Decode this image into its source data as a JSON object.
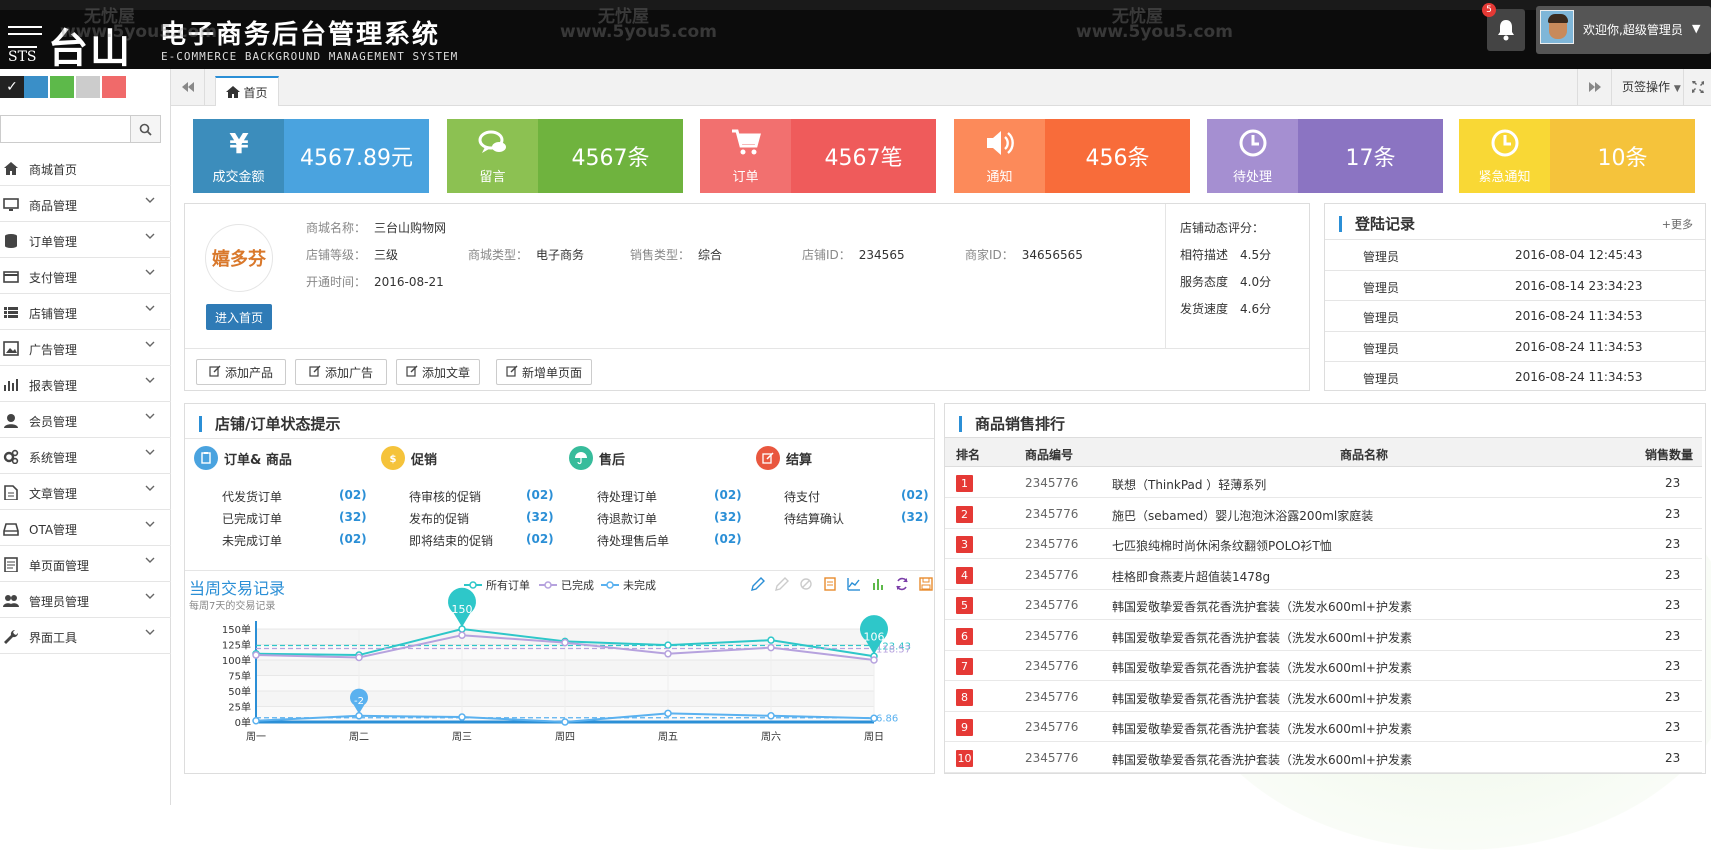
{
  "header": {
    "logo_cn": "台山",
    "logo_sts": "STS",
    "title": "电子商务后台管理系统",
    "subtitle": "E-COMMERCE BACKGROUND MANAGEMENT SYSTEM",
    "notification_count": "5",
    "welcome": "欢迎你,超级管理员"
  },
  "watermarks": {
    "brand": "无忧屋",
    "url": "www.5you5.com"
  },
  "theme_swatches": [
    "#222222",
    "#3a8fc8",
    "#5db94a",
    "#cccccc",
    "#f06a6a"
  ],
  "search": {
    "placeholder": ""
  },
  "sidebar": {
    "items": [
      {
        "label": "商城首页",
        "icon": "home-icon",
        "has_children": false
      },
      {
        "label": "商品管理",
        "icon": "monitor-icon",
        "has_children": true
      },
      {
        "label": "订单管理",
        "icon": "database-icon",
        "has_children": true
      },
      {
        "label": "支付管理",
        "icon": "credit-card-icon",
        "has_children": true
      },
      {
        "label": "店铺管理",
        "icon": "list-icon",
        "has_children": true
      },
      {
        "label": "广告管理",
        "icon": "image-icon",
        "has_children": true
      },
      {
        "label": "报表管理",
        "icon": "bar-chart-icon",
        "has_children": true
      },
      {
        "label": "会员管理",
        "icon": "user-icon",
        "has_children": true
      },
      {
        "label": "系统管理",
        "icon": "cogs-icon",
        "has_children": true
      },
      {
        "label": "文章管理",
        "icon": "file-icon",
        "has_children": true
      },
      {
        "label": "OTA管理",
        "icon": "hdd-icon",
        "has_children": true
      },
      {
        "label": "单页面管理",
        "icon": "file-text-icon",
        "has_children": true
      },
      {
        "label": "管理员管理",
        "icon": "users-icon",
        "has_children": true
      },
      {
        "label": "界面工具",
        "icon": "wrench-icon",
        "has_children": true
      }
    ]
  },
  "tabs": {
    "home_label": "首页",
    "ops_label": "页签操作"
  },
  "stats": [
    {
      "icon": "yen-icon",
      "label": "成交金额",
      "value": "4567.89元",
      "left_color": "#3c8dbc",
      "right_color": "#4aa3df"
    },
    {
      "icon": "comments-icon",
      "label": "留言",
      "value": "4567条",
      "left_color": "#8cc152",
      "right_color": "#6fb33e"
    },
    {
      "icon": "cart-icon",
      "label": "订单",
      "value": "4567笔",
      "left_color": "#f2706f",
      "right_color": "#ef5b5b"
    },
    {
      "icon": "volume-icon",
      "label": "通知",
      "value": "456条",
      "left_color": "#fc8a5a",
      "right_color": "#f86c3a"
    },
    {
      "icon": "clock-icon",
      "label": "待处理",
      "value": "17条",
      "left_color": "#a58fd1",
      "right_color": "#8b74c2"
    },
    {
      "icon": "clock-icon",
      "label": "紧急通知",
      "value": "10条",
      "left_color": "#f9d835",
      "right_color": "#f5c33b"
    }
  ],
  "shop": {
    "logo_text": "嬉多芬",
    "enter_button": "进入首页",
    "name_label": "商城名称：",
    "name": "三台山购物网",
    "level_label": "店铺等级：",
    "level": "三级",
    "type_label": "商城类型：",
    "type": "电子商务",
    "sales_type_label": "销售类型：",
    "sales_type": "综合",
    "id_label": "店铺ID：",
    "id": "234565",
    "merchant_id_label": "商家ID：",
    "merchant_id": "34656565",
    "open_label": "开通时间：",
    "open_time": "2016-08-21",
    "rating_title": "店铺动态评分：",
    "ratings": [
      {
        "label": "相符描述",
        "value": "4.5分"
      },
      {
        "label": "服务态度",
        "value": "4.0分"
      },
      {
        "label": "发货速度",
        "value": "4.6分"
      }
    ],
    "actions": [
      "添加产品",
      "添加广告",
      "添加文章",
      "新增单页面"
    ]
  },
  "login_log": {
    "title": "登陆记录",
    "more": "+更多",
    "rows": [
      {
        "user": "管理员",
        "time": "2016-08-04 12:45:43"
      },
      {
        "user": "管理员",
        "time": "2016-08-14 23:34:23"
      },
      {
        "user": "管理员",
        "time": "2016-08-24 11:34:53"
      },
      {
        "user": "管理员",
        "time": "2016-08-24 11:34:53"
      },
      {
        "user": "管理员",
        "time": "2016-08-24 11:34:53"
      }
    ]
  },
  "status_panel": {
    "title": "店铺/订单状态提示",
    "categories": [
      {
        "title": "订单& 商品",
        "color": "#4aa3df",
        "icon": "clipboard-icon",
        "items": [
          {
            "label": "代发货订单",
            "count": "(02)"
          },
          {
            "label": "已完成订单",
            "count": "(32)"
          },
          {
            "label": "未完成订单",
            "count": "(02)"
          }
        ]
      },
      {
        "title": "促销",
        "color": "#f5c33b",
        "icon": "coin-icon",
        "items": [
          {
            "label": "待审核的促销",
            "count": "(02)"
          },
          {
            "label": "发布的促销",
            "count": "(32)"
          },
          {
            "label": "即将结束的促销",
            "count": "(02)"
          }
        ]
      },
      {
        "title": "售后",
        "color": "#37bc9b",
        "icon": "umbrella-icon",
        "items": [
          {
            "label": "待处理订单",
            "count": "(02)"
          },
          {
            "label": "待退款订单",
            "count": "(32)"
          },
          {
            "label": "待处理售后单",
            "count": "(02)"
          }
        ]
      },
      {
        "title": "结算",
        "color": "#e9573f",
        "icon": "edit-icon",
        "items": [
          {
            "label": "待支付",
            "count": "(02)"
          },
          {
            "label": "待结算确认",
            "count": "(32)"
          }
        ]
      }
    ]
  },
  "chart_data": {
    "type": "line",
    "title": "当周交易记录",
    "subtitle": "每周7天的交易记录",
    "categories": [
      "周一",
      "周二",
      "周三",
      "周四",
      "周五",
      "周六",
      "周日"
    ],
    "y_ticks": [
      "0单",
      "25单",
      "50单",
      "75单",
      "100单",
      "125单",
      "150单"
    ],
    "ylim": [
      0,
      150
    ],
    "series": [
      {
        "name": "所有订单",
        "color": "#2ec7c9",
        "values": [
          110,
          108,
          150,
          130,
          124,
          132,
          106
        ],
        "average": 123.43
      },
      {
        "name": "已完成",
        "color": "#b6a2de",
        "values": [
          108,
          104,
          140,
          128,
          110,
          120,
          100
        ],
        "average": 118.57
      },
      {
        "name": "未完成",
        "color": "#5ab1ef",
        "values": [
          2,
          10,
          8,
          0,
          14,
          10,
          6
        ],
        "average": 6.86
      }
    ],
    "markers": [
      {
        "label": "150",
        "series": 0,
        "index": 2
      },
      {
        "label": "106",
        "series": 0,
        "index": 6
      },
      {
        "label": "-2",
        "series": 2,
        "index": 1
      }
    ],
    "average_labels": [
      "123.43",
      "118.57",
      "6.86"
    ]
  },
  "ranking": {
    "title": "商品销售排行",
    "headers": [
      "排名",
      "商品编号",
      "商品名称",
      "销售数量"
    ],
    "rows": [
      {
        "rank": "1",
        "code": "2345776",
        "name": "联想（ThinkPad ）轻薄系列",
        "qty": "23"
      },
      {
        "rank": "2",
        "code": "2345776",
        "name": "施巴（sebamed）婴儿泡泡沐浴露200ml家庭装",
        "qty": "23"
      },
      {
        "rank": "3",
        "code": "2345776",
        "name": "七匹狼纯棉时尚休闲条纹翻领POLO衫T恤",
        "qty": "23"
      },
      {
        "rank": "4",
        "code": "2345776",
        "name": "桂格即食燕麦片超值装1478g",
        "qty": "23"
      },
      {
        "rank": "5",
        "code": "2345776",
        "name": "韩国爱敬挚爱香氛花香洗护套装（洗发水600ml+护发素",
        "qty": "23"
      },
      {
        "rank": "6",
        "code": "2345776",
        "name": "韩国爱敬挚爱香氛花香洗护套装（洗发水600ml+护发素",
        "qty": "23"
      },
      {
        "rank": "7",
        "code": "2345776",
        "name": "韩国爱敬挚爱香氛花香洗护套装（洗发水600ml+护发素",
        "qty": "23"
      },
      {
        "rank": "8",
        "code": "2345776",
        "name": "韩国爱敬挚爱香氛花香洗护套装（洗发水600ml+护发素",
        "qty": "23"
      },
      {
        "rank": "9",
        "code": "2345776",
        "name": "韩国爱敬挚爱香氛花香洗护套装（洗发水600ml+护发素",
        "qty": "23"
      },
      {
        "rank": "10",
        "code": "2345776",
        "name": "韩国爱敬挚爱香氛花香洗护套装（洗发水600ml+护发素",
        "qty": "23"
      }
    ]
  }
}
